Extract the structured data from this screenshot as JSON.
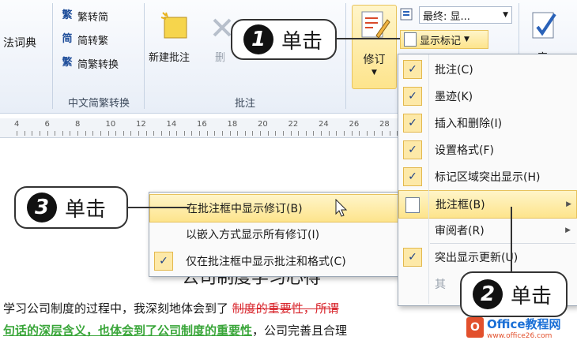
{
  "ribbon": {
    "dict_partial": "法词典",
    "convert": {
      "to_traditional": "繁转简",
      "to_simplified": "简转繁",
      "conversion": "简繁转换",
      "group_label": "中文简繁转换"
    },
    "comments": {
      "new_comment": "新建批注",
      "delete_partial": "删",
      "group_label": "批注"
    },
    "tracking": {
      "track_changes": "修订",
      "final_show": "最终: 显...",
      "show_markup": "显示标记",
      "review_partial": "审"
    }
  },
  "ruler": {
    "ticks": [
      "4",
      "6",
      "8",
      "10",
      "12",
      "14",
      "16",
      "18",
      "20",
      "22",
      "24",
      "26",
      "28"
    ]
  },
  "markup_menu": {
    "items": [
      {
        "label": "批注(C)",
        "checked": true
      },
      {
        "label": "墨迹(K)",
        "checked": true
      },
      {
        "label": "插入和删除(I)",
        "checked": true
      },
      {
        "label": "设置格式(F)",
        "checked": true
      },
      {
        "label": "标记区域突出显示(H)",
        "checked": true
      },
      {
        "label": "批注框(B)",
        "checked": false,
        "submenu": true
      },
      {
        "label": "审阅者(R)",
        "checked": false,
        "submenu": true
      },
      {
        "label": "突出显示更新(U)",
        "checked": true
      },
      {
        "label": "其",
        "checked": false
      }
    ]
  },
  "balloons_menu": {
    "items": [
      {
        "label": "在批注框中显示修订(B)",
        "checked": false
      },
      {
        "label": "以嵌入方式显示所有修订(I)",
        "checked": false
      },
      {
        "label": "仅在批注框中显示批注和格式(C)",
        "checked": true
      }
    ]
  },
  "callouts": {
    "one": {
      "num": "1",
      "text": "单击"
    },
    "two": {
      "num": "2",
      "text": "单击"
    },
    "three": {
      "num": "3",
      "text": "单击"
    }
  },
  "document": {
    "heading_partial": "公司制度学习心得",
    "line1_a": "学习公司制度的过程中，我深刻地体会到了",
    "line1_del": "制度的重要性，所谓",
    "line2_a": "句话的深层含义，也体会到了公司制度的重要性",
    "line2_b": "，公司完善且合理",
    "watermark": "Office教程网",
    "watermark_sub": "www.office26.com"
  },
  "colors": {
    "deleted": "#d8232a",
    "inserted": "#3aa63a",
    "accent": "#e7c25c"
  }
}
